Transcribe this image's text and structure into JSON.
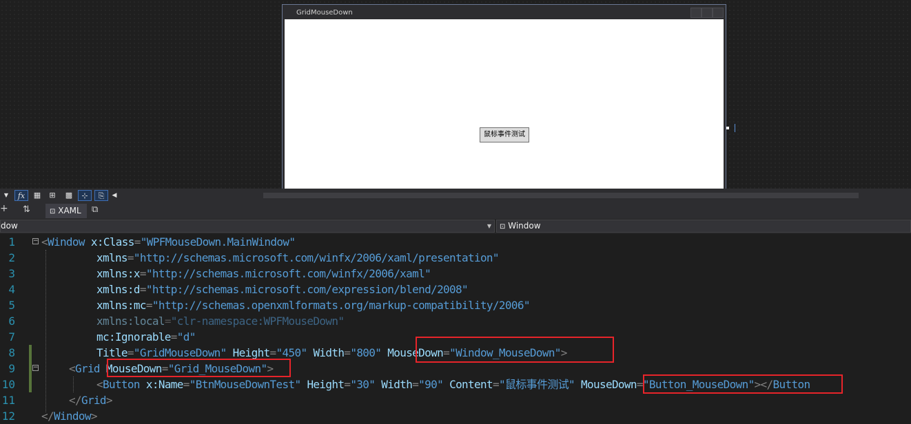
{
  "designer": {
    "window_title": "GridMouseDown",
    "button_content": "鼠标事件测试"
  },
  "toolbar": {
    "fx_label": "fx"
  },
  "tabs": {
    "swap_icon": "swap-arrows-icon",
    "xaml_label": "XAML",
    "popout_icon": "popout-icon"
  },
  "navbar": {
    "left_value": "dow",
    "right_value": "Window"
  },
  "code": {
    "line_numbers": [
      "1",
      "2",
      "3",
      "4",
      "5",
      "6",
      "7",
      "8",
      "9",
      "10",
      "11",
      "12"
    ],
    "l1": {
      "tag": "Window",
      "attr": "x:Class",
      "val": "\"WPFMouseDown.MainWindow\""
    },
    "l2": {
      "attr": "xmlns",
      "val": "\"http://schemas.microsoft.com/winfx/2006/xaml/presentation\""
    },
    "l3": {
      "attr": "xmlns:x",
      "val": "\"http://schemas.microsoft.com/winfx/2006/xaml\""
    },
    "l4": {
      "attr": "xmlns:d",
      "val": "\"http://schemas.microsoft.com/expression/blend/2008\""
    },
    "l5": {
      "attr": "xmlns:mc",
      "val": "\"http://schemas.openxmlformats.org/markup-compatibility/2006\""
    },
    "l6": {
      "attr": "xmlns:local",
      "val": "\"clr-namespace:WPFMouseDown\""
    },
    "l7": {
      "attr": "mc:Ignorable",
      "val": "\"d\""
    },
    "l8": {
      "a1": "Title",
      "v1": "\"GridMouseDown\"",
      "a2": "Height",
      "v2": "\"450\"",
      "a3": "Width",
      "v3": "\"800\"",
      "a4": "MouseDown",
      "v4": "\"Window_MouseDown\""
    },
    "l9": {
      "tag": "Grid",
      "attr": "MouseDown",
      "val": "\"Grid_MouseDown\""
    },
    "l10": {
      "tag": "Button",
      "a1": "x:Name",
      "v1": "\"BtnMouseDownTest\"",
      "a2": "Height",
      "v2": "\"30\"",
      "a3": "Width",
      "v3": "\"90\"",
      "a4": "Content",
      "v4": "\"鼠标事件测试\"",
      "a5": "MouseDown",
      "v5": "\"Button_MouseDown\"",
      "close": "Button"
    },
    "l11": {
      "tag": "Grid"
    },
    "l12": {
      "tag": "Window"
    }
  }
}
